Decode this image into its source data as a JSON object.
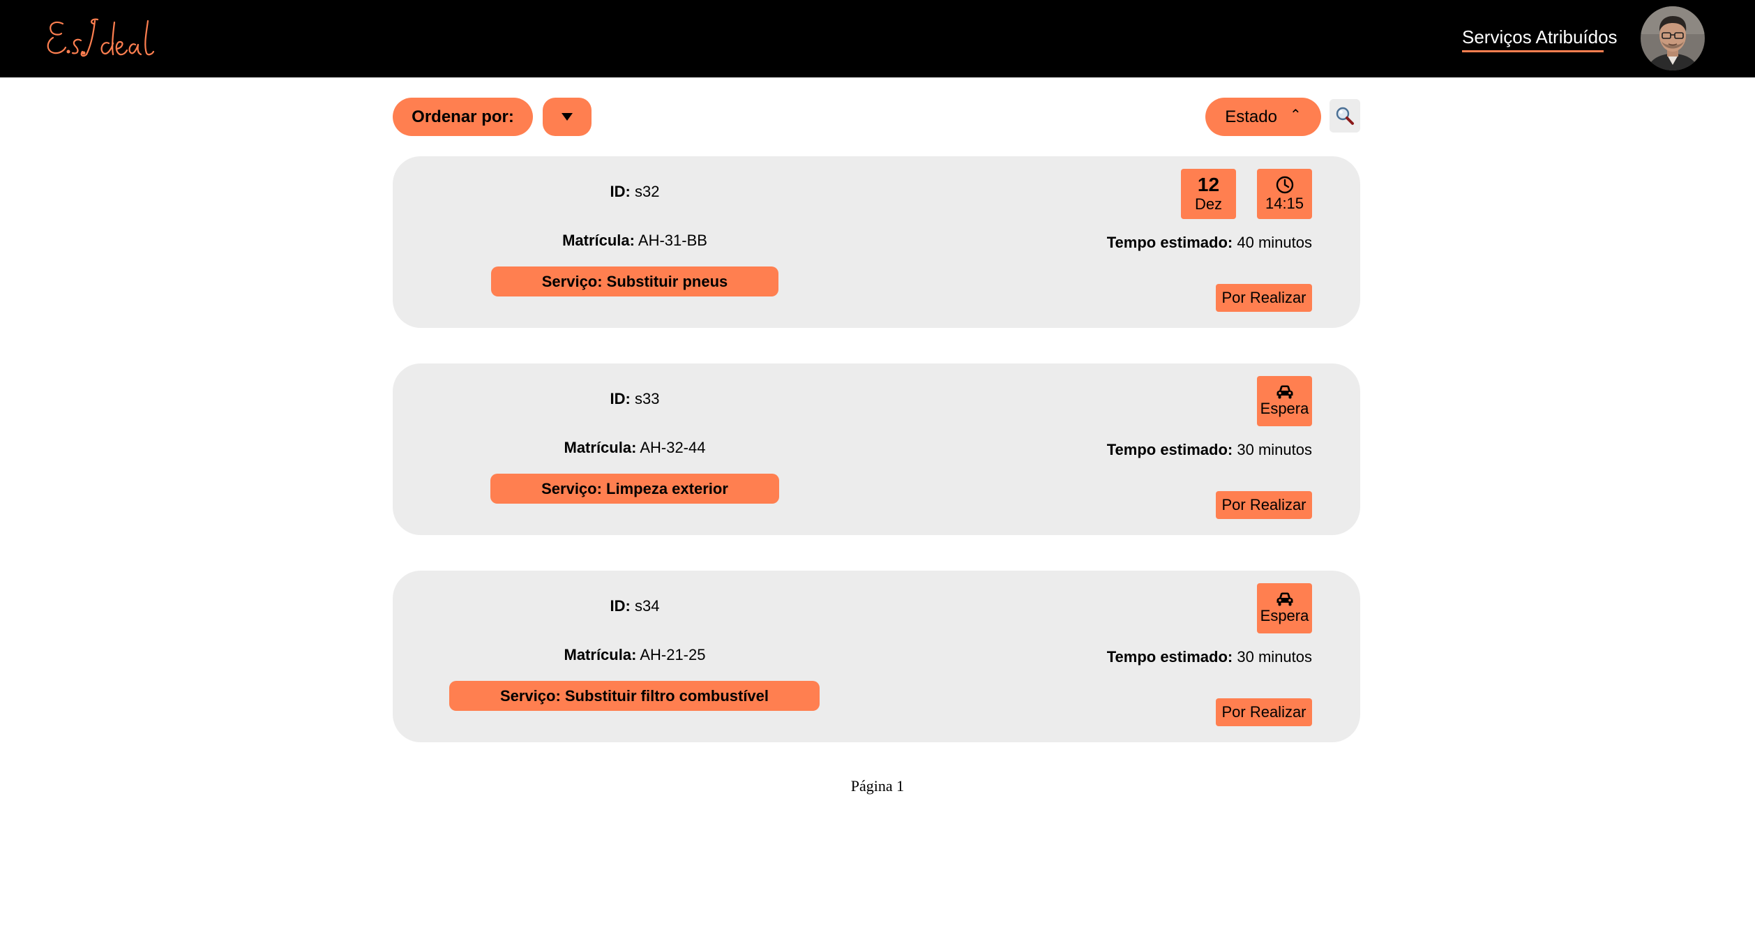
{
  "header": {
    "logo_text": "E.S.Ideal",
    "nav_link": "Serviços Atribuídos",
    "avatar_icon": "user-avatar"
  },
  "toolbar": {
    "sort_label": "Ordenar por:",
    "sort_toggle_icon": "triangle-down-icon",
    "filter_label": "Estado",
    "filter_caret": "⌃",
    "search_icon": "search-icon"
  },
  "colors": {
    "accent": "#ff7f50",
    "card_bg": "#ececec",
    "header_bg": "#000000"
  },
  "services": [
    {
      "id_label": "ID:",
      "id": "s32",
      "plate_label": "Matrícula:",
      "plate": "AH-31-BB",
      "service": "Serviço: Substituir pneus",
      "badges": [
        {
          "type": "date",
          "day": "12",
          "month": "Dez"
        },
        {
          "type": "time",
          "icon": "clock-icon",
          "time": "14:15"
        }
      ],
      "time_label": "Tempo estimado:",
      "time_value": "40 minutos",
      "status": "Por Realizar"
    },
    {
      "id_label": "ID:",
      "id": "s33",
      "plate_label": "Matrícula:",
      "plate": "AH-32-44",
      "service": "Serviço: Limpeza exterior",
      "badges": [
        {
          "type": "wait",
          "icon": "car-icon",
          "label": "Espera"
        }
      ],
      "time_label": "Tempo estimado:",
      "time_value": "30 minutos",
      "status": "Por Realizar"
    },
    {
      "id_label": "ID:",
      "id": "s34",
      "plate_label": "Matrícula:",
      "plate": "AH-21-25",
      "service": "Serviço: Substituir filtro combustível",
      "badges": [
        {
          "type": "wait",
          "icon": "car-icon",
          "label": "Espera"
        }
      ],
      "time_label": "Tempo estimado:",
      "time_value": "30 minutos",
      "status": "Por Realizar"
    }
  ],
  "footer": {
    "page_label": "Página 1"
  }
}
